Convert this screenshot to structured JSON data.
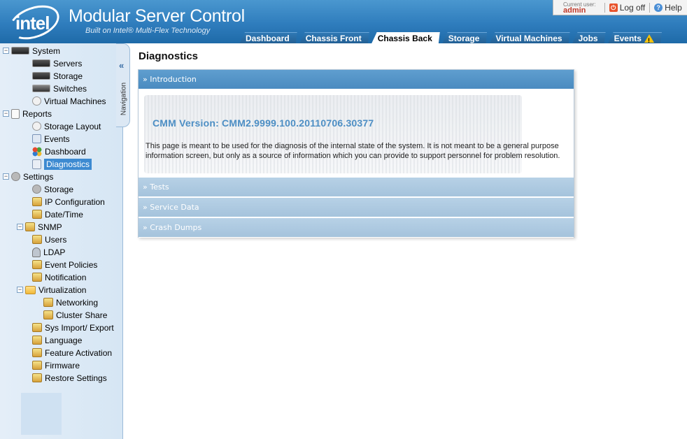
{
  "header": {
    "logo_text": "intel",
    "title": "Modular Server Control",
    "subtitle": "Built on Intel® Multi-Flex Technology",
    "current_user_label": "Current user:",
    "current_user": "admin",
    "logoff_label": "Log off",
    "help_label": "Help"
  },
  "tabs": [
    {
      "label": "Dashboard",
      "active": false
    },
    {
      "label": "Chassis Front",
      "active": false
    },
    {
      "label": "Chassis Back",
      "active": true
    },
    {
      "label": "Storage",
      "active": false
    },
    {
      "label": "Virtual Machines",
      "active": false
    },
    {
      "label": "Jobs",
      "active": false
    },
    {
      "label": "Events",
      "active": false,
      "icon": "warning-icon"
    }
  ],
  "sidebar": {
    "collapse_glyph": "«",
    "handle_label": "Navigation",
    "items": [
      {
        "label": "System",
        "icon": "server-icon",
        "toggle": "−"
      },
      {
        "label": "Servers",
        "icon": "server-icon"
      },
      {
        "label": "Storage",
        "icon": "storage-icon"
      },
      {
        "label": "Switches",
        "icon": "switch-icon"
      },
      {
        "label": "Virtual Machines",
        "icon": "virtual-machine-icon"
      },
      {
        "label": "Reports",
        "icon": "document-icon",
        "toggle": "−"
      },
      {
        "label": "Storage Layout",
        "icon": "storage-layout-icon"
      },
      {
        "label": "Events",
        "icon": "events-icon"
      },
      {
        "label": "Dashboard",
        "icon": "dashboard-icon"
      },
      {
        "label": "Diagnostics",
        "icon": "diagnostics-icon",
        "selected": true
      },
      {
        "label": "Settings",
        "icon": "gear-icon",
        "toggle": "−"
      },
      {
        "label": "Storage",
        "icon": "gear-icon"
      },
      {
        "label": "IP Configuration",
        "icon": "config-icon"
      },
      {
        "label": "Date/Time",
        "icon": "config-icon"
      },
      {
        "label": "SNMP",
        "icon": "config-icon",
        "toggle": "−"
      },
      {
        "label": "Users",
        "icon": "config-icon"
      },
      {
        "label": "LDAP",
        "icon": "ldap-icon"
      },
      {
        "label": "Event Policies",
        "icon": "config-icon"
      },
      {
        "label": "Notification",
        "icon": "config-icon"
      },
      {
        "label": "Virtualization",
        "icon": "folder-icon",
        "toggle": "−"
      },
      {
        "label": "Networking",
        "icon": "config-icon"
      },
      {
        "label": "Cluster Share",
        "icon": "config-icon"
      },
      {
        "label": "Sys Import/ Export",
        "icon": "config-icon"
      },
      {
        "label": "Language",
        "icon": "config-icon"
      },
      {
        "label": "Feature Activation",
        "icon": "config-icon"
      },
      {
        "label": "Firmware",
        "icon": "config-icon"
      },
      {
        "label": "Restore Settings",
        "icon": "config-icon"
      }
    ]
  },
  "main": {
    "title": "Diagnostics",
    "sections": [
      {
        "label": "» Introduction",
        "open": true
      },
      {
        "label": "» Tests",
        "open": false
      },
      {
        "label": "» Service Data",
        "open": false
      },
      {
        "label": "» Crash Dumps",
        "open": false
      }
    ],
    "cmm_version": "CMM Version: CMM2.9999.100.20110706.30377",
    "intro_text": "This page is meant to be used for the diagnosis of the internal state of the system. It is not meant to be a general purpose information screen, but only as a source of information which you can provide to support personnel for problem resolution."
  }
}
